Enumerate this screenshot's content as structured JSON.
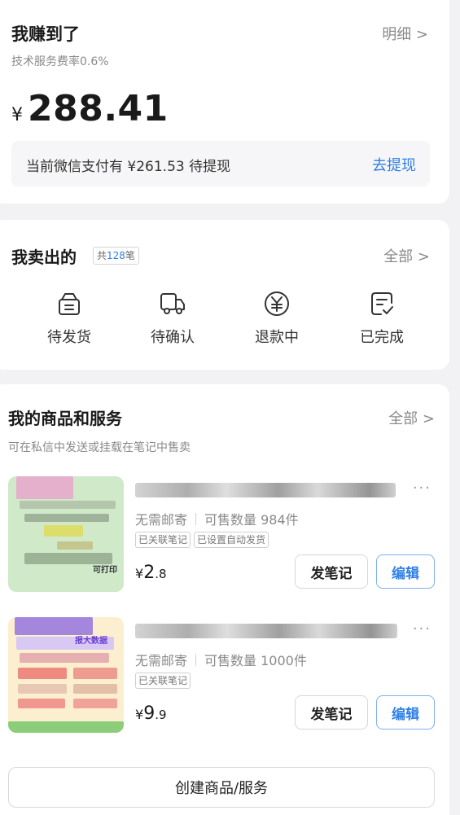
{
  "earnings": {
    "title": "我赚到了",
    "fee_rate": "技术服务费率0.6%",
    "detail_link": "明细 >",
    "currency": "¥",
    "amount": "288.41",
    "wechat_pending": "当前微信支付有 ¥261.53 待提现",
    "withdraw_link": "去提现"
  },
  "sold": {
    "title": "我卖出的",
    "count_prefix": "共",
    "count": "128",
    "count_suffix": "笔",
    "all_link": "全部 >",
    "statuses": [
      {
        "label": "待发货",
        "icon": "box-icon"
      },
      {
        "label": "待确认",
        "icon": "truck-icon"
      },
      {
        "label": "退款中",
        "icon": "yuan-refund-icon"
      },
      {
        "label": "已完成",
        "icon": "check-doc-icon"
      }
    ]
  },
  "products": {
    "title": "我的商品和服务",
    "all_link": "全部 >",
    "subtitle": "可在私信中发送或挂载在笔记中售卖",
    "items": [
      {
        "shipping": "无需邮寄",
        "stock": "可售数量 984件",
        "tags": [
          "已关联笔记",
          "已设置自动发货"
        ],
        "price_currency": "¥",
        "price_int": "2",
        "price_dec": ".8",
        "more": "···",
        "note_button": "发笔记",
        "edit_button": "编辑",
        "thumb_text": "可打印"
      },
      {
        "shipping": "无需邮寄",
        "stock": "可售数量 1000件",
        "tags": [
          "已关联笔记"
        ],
        "price_currency": "¥",
        "price_int": "9",
        "price_dec": ".9",
        "more": "···",
        "note_button": "发笔记",
        "edit_button": "编辑",
        "thumb_text": "报大数据"
      }
    ],
    "create_button": "创建商品/服务"
  },
  "colors": {
    "accent": "#2f7fe6",
    "background": "#f2f2f4",
    "card": "#ffffff",
    "muted": "#8a8a8a"
  }
}
